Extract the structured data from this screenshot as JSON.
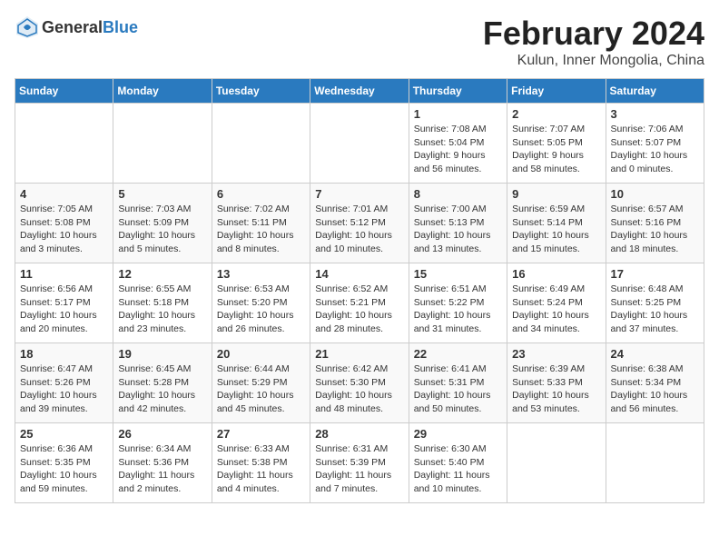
{
  "header": {
    "logo_general": "General",
    "logo_blue": "Blue",
    "title": "February 2024",
    "location": "Kulun, Inner Mongolia, China"
  },
  "days_of_week": [
    "Sunday",
    "Monday",
    "Tuesday",
    "Wednesday",
    "Thursday",
    "Friday",
    "Saturday"
  ],
  "weeks": [
    [
      {
        "day": "",
        "info": ""
      },
      {
        "day": "",
        "info": ""
      },
      {
        "day": "",
        "info": ""
      },
      {
        "day": "",
        "info": ""
      },
      {
        "day": "1",
        "info": "Sunrise: 7:08 AM\nSunset: 5:04 PM\nDaylight: 9 hours\nand 56 minutes."
      },
      {
        "day": "2",
        "info": "Sunrise: 7:07 AM\nSunset: 5:05 PM\nDaylight: 9 hours\nand 58 minutes."
      },
      {
        "day": "3",
        "info": "Sunrise: 7:06 AM\nSunset: 5:07 PM\nDaylight: 10 hours\nand 0 minutes."
      }
    ],
    [
      {
        "day": "4",
        "info": "Sunrise: 7:05 AM\nSunset: 5:08 PM\nDaylight: 10 hours\nand 3 minutes."
      },
      {
        "day": "5",
        "info": "Sunrise: 7:03 AM\nSunset: 5:09 PM\nDaylight: 10 hours\nand 5 minutes."
      },
      {
        "day": "6",
        "info": "Sunrise: 7:02 AM\nSunset: 5:11 PM\nDaylight: 10 hours\nand 8 minutes."
      },
      {
        "day": "7",
        "info": "Sunrise: 7:01 AM\nSunset: 5:12 PM\nDaylight: 10 hours\nand 10 minutes."
      },
      {
        "day": "8",
        "info": "Sunrise: 7:00 AM\nSunset: 5:13 PM\nDaylight: 10 hours\nand 13 minutes."
      },
      {
        "day": "9",
        "info": "Sunrise: 6:59 AM\nSunset: 5:14 PM\nDaylight: 10 hours\nand 15 minutes."
      },
      {
        "day": "10",
        "info": "Sunrise: 6:57 AM\nSunset: 5:16 PM\nDaylight: 10 hours\nand 18 minutes."
      }
    ],
    [
      {
        "day": "11",
        "info": "Sunrise: 6:56 AM\nSunset: 5:17 PM\nDaylight: 10 hours\nand 20 minutes."
      },
      {
        "day": "12",
        "info": "Sunrise: 6:55 AM\nSunset: 5:18 PM\nDaylight: 10 hours\nand 23 minutes."
      },
      {
        "day": "13",
        "info": "Sunrise: 6:53 AM\nSunset: 5:20 PM\nDaylight: 10 hours\nand 26 minutes."
      },
      {
        "day": "14",
        "info": "Sunrise: 6:52 AM\nSunset: 5:21 PM\nDaylight: 10 hours\nand 28 minutes."
      },
      {
        "day": "15",
        "info": "Sunrise: 6:51 AM\nSunset: 5:22 PM\nDaylight: 10 hours\nand 31 minutes."
      },
      {
        "day": "16",
        "info": "Sunrise: 6:49 AM\nSunset: 5:24 PM\nDaylight: 10 hours\nand 34 minutes."
      },
      {
        "day": "17",
        "info": "Sunrise: 6:48 AM\nSunset: 5:25 PM\nDaylight: 10 hours\nand 37 minutes."
      }
    ],
    [
      {
        "day": "18",
        "info": "Sunrise: 6:47 AM\nSunset: 5:26 PM\nDaylight: 10 hours\nand 39 minutes."
      },
      {
        "day": "19",
        "info": "Sunrise: 6:45 AM\nSunset: 5:28 PM\nDaylight: 10 hours\nand 42 minutes."
      },
      {
        "day": "20",
        "info": "Sunrise: 6:44 AM\nSunset: 5:29 PM\nDaylight: 10 hours\nand 45 minutes."
      },
      {
        "day": "21",
        "info": "Sunrise: 6:42 AM\nSunset: 5:30 PM\nDaylight: 10 hours\nand 48 minutes."
      },
      {
        "day": "22",
        "info": "Sunrise: 6:41 AM\nSunset: 5:31 PM\nDaylight: 10 hours\nand 50 minutes."
      },
      {
        "day": "23",
        "info": "Sunrise: 6:39 AM\nSunset: 5:33 PM\nDaylight: 10 hours\nand 53 minutes."
      },
      {
        "day": "24",
        "info": "Sunrise: 6:38 AM\nSunset: 5:34 PM\nDaylight: 10 hours\nand 56 minutes."
      }
    ],
    [
      {
        "day": "25",
        "info": "Sunrise: 6:36 AM\nSunset: 5:35 PM\nDaylight: 10 hours\nand 59 minutes."
      },
      {
        "day": "26",
        "info": "Sunrise: 6:34 AM\nSunset: 5:36 PM\nDaylight: 11 hours\nand 2 minutes."
      },
      {
        "day": "27",
        "info": "Sunrise: 6:33 AM\nSunset: 5:38 PM\nDaylight: 11 hours\nand 4 minutes."
      },
      {
        "day": "28",
        "info": "Sunrise: 6:31 AM\nSunset: 5:39 PM\nDaylight: 11 hours\nand 7 minutes."
      },
      {
        "day": "29",
        "info": "Sunrise: 6:30 AM\nSunset: 5:40 PM\nDaylight: 11 hours\nand 10 minutes."
      },
      {
        "day": "",
        "info": ""
      },
      {
        "day": "",
        "info": ""
      }
    ]
  ]
}
